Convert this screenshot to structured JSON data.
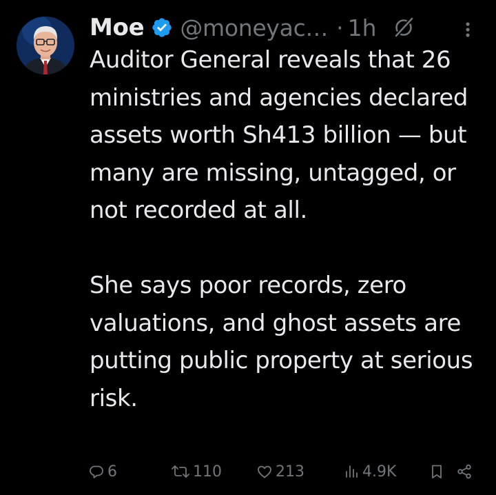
{
  "author": {
    "display_name": "Moe",
    "handle": "@moneyac…",
    "separator": "·",
    "time": "1h",
    "verified": true,
    "verified_color": "#1d9bf0"
  },
  "tweet": {
    "paragraphs": [
      "Auditor General reveals that 26 ministries and agencies declared assets worth Sh413 billion — but many are missing, untagged, or not recorded at all.",
      "She says poor records, zero valuations, and ghost assets are putting public property at serious risk."
    ]
  },
  "actions": {
    "reply_count": "6",
    "retweet_count": "110",
    "like_count": "213",
    "views_count": "4.9K"
  },
  "icons": {
    "verified": "verified-badge-icon",
    "grok": "grok-icon",
    "more": "more-vertical-icon",
    "reply": "reply-icon",
    "retweet": "retweet-icon",
    "like": "heart-icon",
    "views": "views-chart-icon",
    "bookmark": "bookmark-icon",
    "share": "share-icon"
  },
  "colors": {
    "background": "#000000",
    "text_primary": "#e7e9ea",
    "text_secondary": "#71767b",
    "accent": "#1d9bf0"
  }
}
